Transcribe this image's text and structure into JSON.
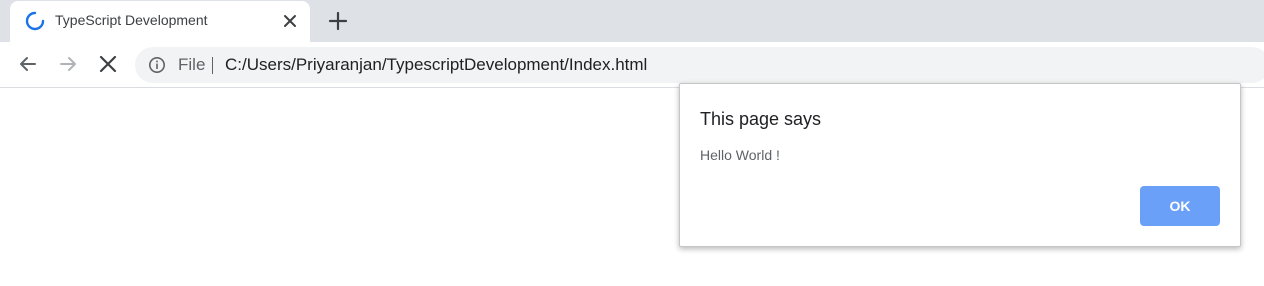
{
  "tab": {
    "title": "TypeScript Development"
  },
  "toolbar": {
    "scheme_label": "File",
    "url": "C:/Users/Priyaranjan/TypescriptDevelopment/Index.html"
  },
  "dialog": {
    "title": "This page says",
    "message": "Hello World !",
    "ok_label": "OK"
  },
  "icons": {
    "tab_spinner": "loading-spinner-icon",
    "tab_close": "close-icon",
    "new_tab": "plus-icon",
    "back": "arrow-left-icon",
    "forward": "arrow-right-icon",
    "stop": "stop-icon",
    "info": "info-icon"
  },
  "colors": {
    "tabstrip_bg": "#dee1e6",
    "omnibox_bg": "#f1f3f4",
    "spinner": "#1a73e8",
    "ok_button": "#6aa0f7"
  }
}
